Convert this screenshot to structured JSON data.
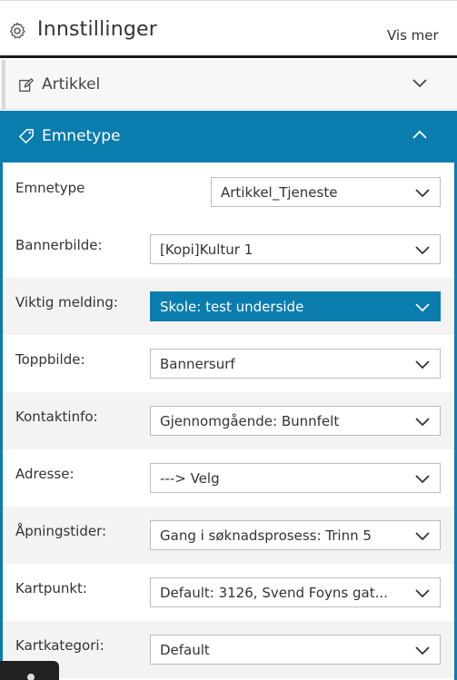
{
  "header": {
    "title": "Innstillinger",
    "more_label": "Vis mer",
    "icon": "gear-icon"
  },
  "sections": {
    "article": {
      "label": "Artikkel",
      "icon": "edit-icon",
      "state": "collapsed"
    },
    "topic_type": {
      "label": "Emnetype",
      "icon": "tag-icon",
      "state": "expanded"
    }
  },
  "fields": [
    {
      "label": "Emnetype",
      "value": "Artikkel_Tjeneste"
    },
    {
      "label": "Bannerbilde:",
      "value": "[Kopi]Kultur 1"
    },
    {
      "label": "Viktig melding:",
      "value": "Skole: test underside"
    },
    {
      "label": "Toppbilde:",
      "value": "Bannersurf"
    },
    {
      "label": "Kontaktinfo:",
      "value": "Gjennomgående: Bunnfelt"
    },
    {
      "label": "Adresse:",
      "value": "---> Velg"
    },
    {
      "label": "Åpningstider:",
      "value": "Gang i søknadsprosess: Trinn 5"
    },
    {
      "label": "Kartpunkt:",
      "value": "Default: 3126, Svend Foyns gat..."
    },
    {
      "label": "Kartkategori:",
      "value": "Default"
    }
  ],
  "colors": {
    "accent": "#0a7cae",
    "row_alt": "#f3f3f3",
    "header_rule": "#1a1a1a"
  }
}
